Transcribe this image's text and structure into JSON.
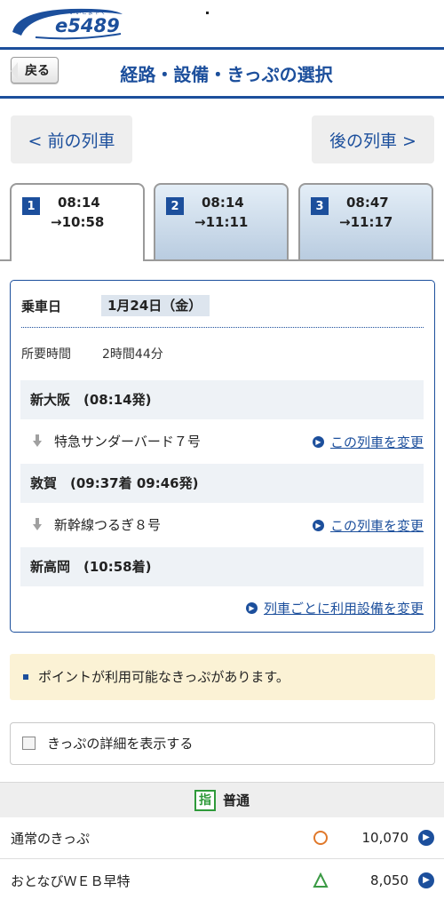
{
  "header": {
    "logo_text": "e5489",
    "logo_ruby": "いいごよやく",
    "back_label": "戻る",
    "title": "経路・設備・きっぷの選択"
  },
  "nav": {
    "prev_label": "< 前の列車",
    "next_label": "後の列車 >"
  },
  "tabs": [
    {
      "num": "1",
      "dep": "08:14",
      "arr": "→10:58",
      "active": true
    },
    {
      "num": "2",
      "dep": "08:14",
      "arr": "→11:11",
      "active": false
    },
    {
      "num": "3",
      "dep": "08:47",
      "arr": "→11:17",
      "active": false
    }
  ],
  "route": {
    "date_label": "乗車日",
    "date_value": "1月24日（金）",
    "duration_label": "所要時間",
    "duration_value": "2時間44分",
    "stations": [
      "新大阪　(08:14発)",
      "敦賀　(09:37着 09:46発)",
      "新高岡　(10:58着)"
    ],
    "trains": [
      {
        "name": "特急サンダーバード７号",
        "change_label": "この列車を変更"
      },
      {
        "name": "新幹線つるぎ８号",
        "change_label": "この列車を変更"
      }
    ],
    "facility_link": "列車ごとに利用設備を変更"
  },
  "notice": "ポイントが利用可能なきっぷがあります。",
  "detail_toggle": "きっぷの詳細を表示する",
  "fare_class": {
    "icon_label": "指",
    "name": "普通"
  },
  "fares": [
    {
      "name": "通常のきっぷ",
      "mark": "circle",
      "price": "10,070"
    },
    {
      "name": "おとなびＷＥＢ早特",
      "mark": "triangle",
      "price": "8,050"
    }
  ],
  "colors": {
    "brand_blue": "#1c4f9c",
    "reserved_green": "#2f9a3a",
    "circle_orange": "#e0782a",
    "triangle_green": "#3a9a44",
    "notice_bg": "#fbf2d5"
  }
}
